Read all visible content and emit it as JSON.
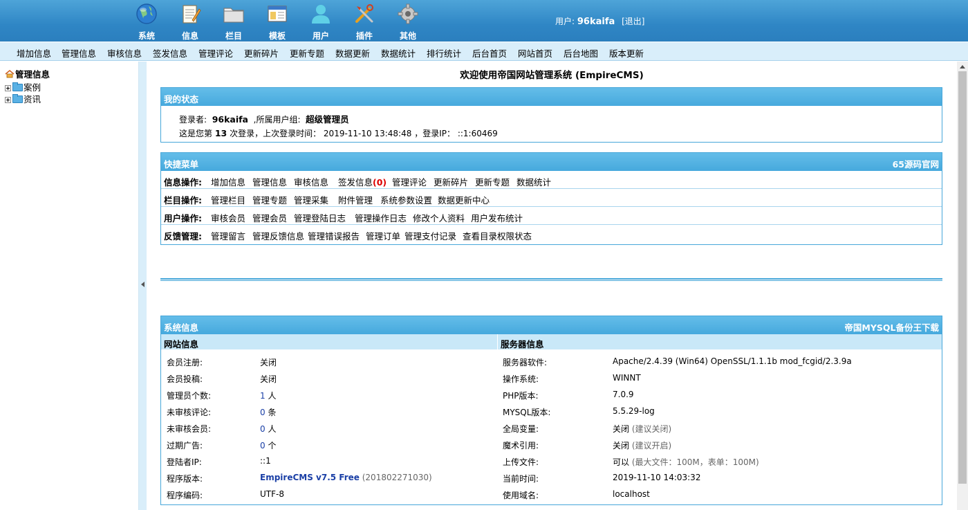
{
  "header": {
    "nav": [
      {
        "label": "系统",
        "icon": "globe-icon"
      },
      {
        "label": "信息",
        "icon": "notepad-icon"
      },
      {
        "label": "栏目",
        "icon": "folder-icon"
      },
      {
        "label": "模板",
        "icon": "template-window-icon"
      },
      {
        "label": "用户",
        "icon": "user-icon"
      },
      {
        "label": "插件",
        "icon": "tools-icon"
      },
      {
        "label": "其他",
        "icon": "gear-icon"
      }
    ],
    "user_prefix": "用户:",
    "username": "96kaifa",
    "logout": "[退出]"
  },
  "submenu": [
    "增加信息",
    "管理信息",
    "审核信息",
    "签发信息",
    "管理评论",
    "更新碎片",
    "更新专题",
    "数据更新",
    "数据统计",
    "排行统计",
    "后台首页",
    "网站首页",
    "后台地图",
    "版本更新"
  ],
  "tree": {
    "root": "管理信息",
    "nodes": [
      "案例",
      "资讯"
    ]
  },
  "main": {
    "welcome": "欢迎使用帝国网站管理系统 (EmpireCMS)",
    "status": {
      "title": "我的状态",
      "login_label": "登录者:",
      "login_user": "96kaifa",
      "group_label": ",所属用户组:",
      "group": "超级管理员",
      "count_prefix": "这是您第",
      "count": "13",
      "count_suffix": "次登录，上次登录时间：",
      "last_time": "2019-11-10 13:48:48",
      "ip_label": "，登录IP：",
      "ip": "::1:60469"
    },
    "quick": {
      "title": "快捷菜单",
      "right_link": "65源码官网",
      "rows": [
        {
          "label": "信息操作:",
          "links": [
            "增加信息",
            "管理信息",
            "审核信息",
            "签发信息",
            "管理评论",
            "更新碎片",
            "更新专题",
            "数据统计"
          ],
          "badge": "(0)"
        },
        {
          "label": "栏目操作:",
          "links": [
            "管理栏目",
            "管理专题",
            "管理采集",
            "附件管理",
            "系统参数设置",
            "数据更新中心"
          ]
        },
        {
          "label": "用户操作:",
          "links": [
            "审核会员",
            "管理会员",
            "管理登陆日志",
            "管理操作日志",
            "修改个人资料",
            "用户发布统计"
          ]
        },
        {
          "label": "反馈管理:",
          "links": [
            "管理留言",
            "管理反馈信息",
            "管理错误报告",
            "管理订单",
            "管理支付记录",
            "查看目录权限状态"
          ]
        }
      ]
    },
    "sys": {
      "title": "系统信息",
      "right_link": "帝国MYSQL备份王下载",
      "site_head": "网站信息",
      "server_head": "服务器信息",
      "site": [
        {
          "k": "会员注册:",
          "v": "关闭"
        },
        {
          "k": "会员投稿:",
          "v": "关闭"
        },
        {
          "k": "管理员个数:",
          "v": "1",
          "unit": " 人"
        },
        {
          "k": "未审核评论:",
          "v": "0",
          "unit": " 条"
        },
        {
          "k": "未审核会员:",
          "v": "0",
          "unit": " 人"
        },
        {
          "k": "过期广告:",
          "v": "0",
          "unit": " 个"
        },
        {
          "k": "登陆者IP:",
          "v": "::1"
        },
        {
          "k": "程序版本:",
          "v": "EmpireCMS v7.5 Free",
          "extra": " (201802271030)"
        },
        {
          "k": "程序编码:",
          "v": "UTF-8"
        }
      ],
      "server": [
        {
          "k": "服务器软件:",
          "v": "Apache/2.4.39 (Win64) OpenSSL/1.1.1b mod_fcgid/2.3.9a"
        },
        {
          "k": "操作系统:",
          "v": "WINNT"
        },
        {
          "k": "PHP版本:",
          "v": "7.0.9"
        },
        {
          "k": "MYSQL版本:",
          "v": "5.5.29-log"
        },
        {
          "k": "全局变量:",
          "v": "关闭",
          "extra": " (建议关闭)"
        },
        {
          "k": "魔术引用:",
          "v": "关闭",
          "extra": " (建议开启)"
        },
        {
          "k": "上传文件:",
          "v": "可以",
          "extra": " (最大文件：100M，表单：100M)"
        },
        {
          "k": "当前时间:",
          "v": "2019-11-10 14:03:32"
        },
        {
          "k": "使用域名:",
          "v": "localhost"
        }
      ]
    }
  },
  "colors": {
    "header": "#2f86c5",
    "submenu_bg": "#d9eefa",
    "box_border": "#46a6d9",
    "accent_red": "#dd0000"
  }
}
